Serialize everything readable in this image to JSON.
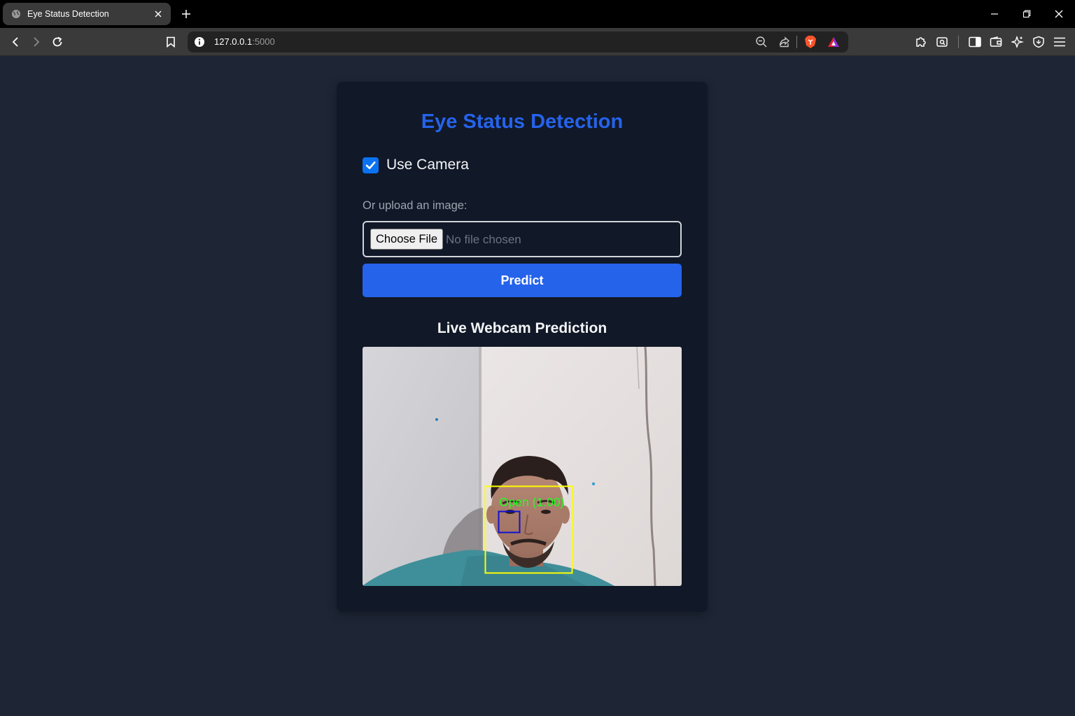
{
  "browser": {
    "tab_title": "Eye Status Detection",
    "url_host": "127.0.0.1",
    "url_port": ":5000"
  },
  "page": {
    "title": "Eye Status Detection",
    "use_camera_label": "Use Camera",
    "use_camera_checked": true,
    "upload_label": "Or upload an image:",
    "choose_file_label": "Choose File",
    "no_file_text": "No file chosen",
    "predict_label": "Predict",
    "live_title": "Live Webcam Prediction",
    "prediction_overlay": "Open (1.00)"
  },
  "colors": {
    "page_bg": "#1e2636",
    "card_bg": "#111827",
    "accent": "#2563eb",
    "face_box": "#ffff00",
    "eye_box": "#1010d0",
    "prediction_text": "#1fff1f"
  },
  "icons": [
    "globe-icon",
    "close-icon",
    "plus-icon",
    "minimize-icon",
    "restore-icon",
    "back-icon",
    "forward-icon",
    "reload-icon",
    "bookmark-icon",
    "info-icon",
    "zoom-out-icon",
    "share-icon",
    "brave-shield-icon",
    "rewards-icon",
    "extensions-icon",
    "screenshot-icon",
    "sidebar-icon",
    "wallet-icon",
    "leo-icon",
    "vpn-icon",
    "menu-icon"
  ]
}
